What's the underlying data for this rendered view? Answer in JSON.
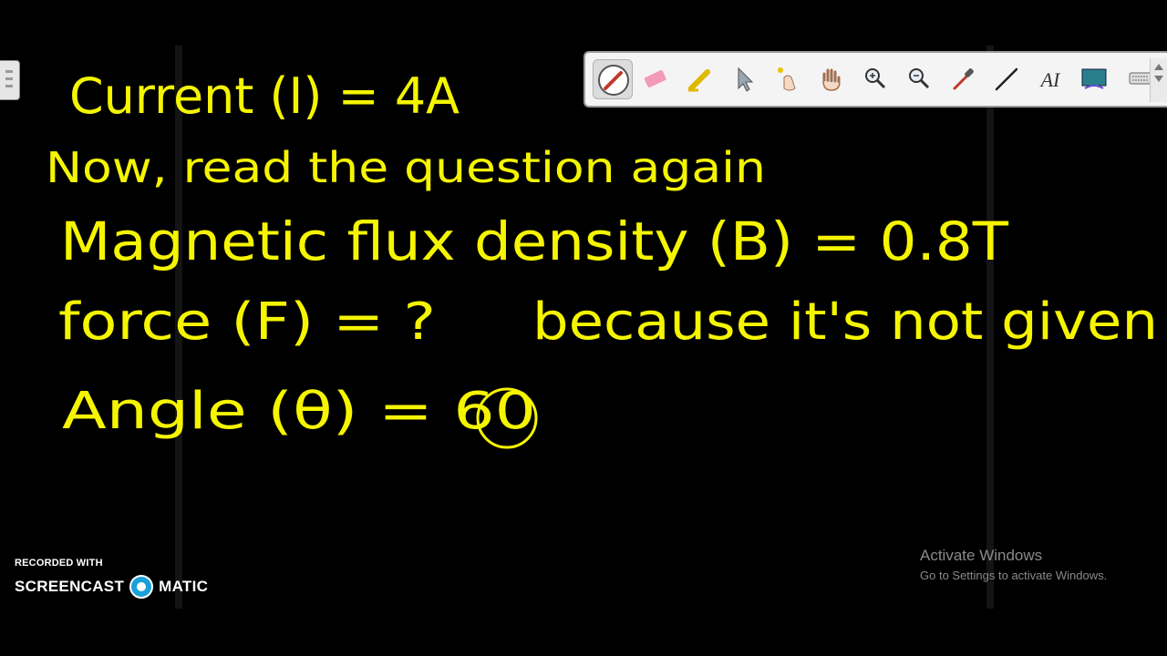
{
  "toolbar": {
    "tools": [
      {
        "name": "pen-icon",
        "active": true
      },
      {
        "name": "eraser-icon"
      },
      {
        "name": "highlighter-icon"
      },
      {
        "name": "pointer-icon"
      },
      {
        "name": "laser-pointer-icon"
      },
      {
        "name": "pan-hand-icon"
      },
      {
        "name": "zoom-in-icon"
      },
      {
        "name": "zoom-out-icon"
      },
      {
        "name": "eyedropper-icon"
      },
      {
        "name": "line-icon"
      },
      {
        "name": "text-icon",
        "glyph": "AI"
      },
      {
        "name": "screen-capture-icon"
      },
      {
        "name": "keyboard-icon"
      }
    ]
  },
  "board": {
    "ink_color": "#f5f500",
    "lines": [
      "Current (I) = 4A",
      "Now, read the question again",
      "Magnetic flux density (B) = 0.8T",
      "force (F) = ?",
      "because it's not given",
      "Angle (θ) = 60"
    ]
  },
  "watermark": {
    "top": "RECORDED WITH",
    "left_word": "SCREENCAST",
    "right_word": "MATIC"
  },
  "activation": {
    "title": "Activate Windows",
    "subtitle": "Go to Settings to activate Windows."
  }
}
